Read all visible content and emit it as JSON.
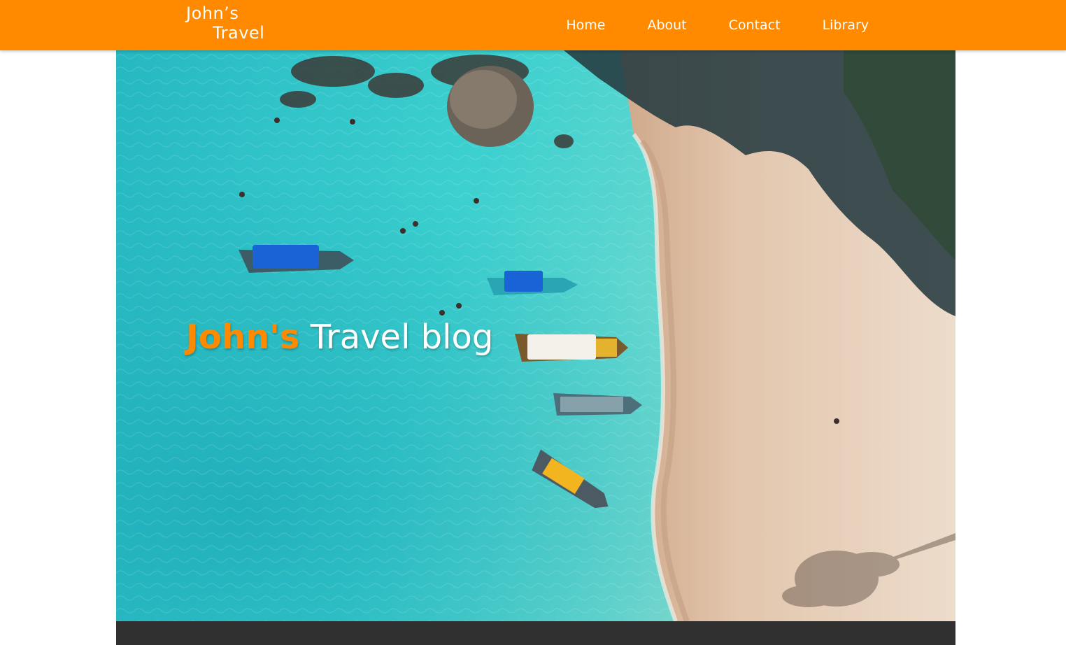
{
  "header": {
    "logo_line1": "John’s",
    "logo_line2": "Travel",
    "nav": [
      {
        "label": "Home"
      },
      {
        "label": "About"
      },
      {
        "label": "Contact"
      },
      {
        "label": "Library"
      }
    ]
  },
  "hero": {
    "title_accent": "John's",
    "title_rest": "Travel blog"
  },
  "colors": {
    "accent": "#ff8a00",
    "footer": "#303030",
    "water": "#2cc3c8",
    "sand": "#d9b99b"
  }
}
